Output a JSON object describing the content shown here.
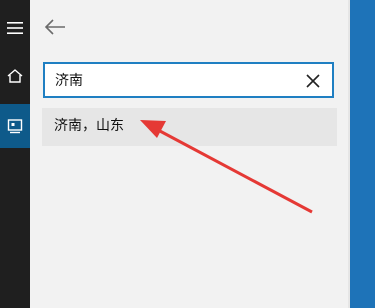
{
  "search": {
    "value": "济南"
  },
  "suggestions": [
    {
      "label": "济南，山东"
    }
  ],
  "icons": {
    "menu": "hamburger-menu-icon",
    "home": "home-icon",
    "selected": "map-board-icon",
    "back": "back-arrow-icon",
    "clear": "close-icon"
  },
  "colors": {
    "accent": "#1f7fc2",
    "annotation_arrow": "#e53935",
    "rail": "#1f1f1f",
    "rail_selected": "#0e5a8a"
  }
}
